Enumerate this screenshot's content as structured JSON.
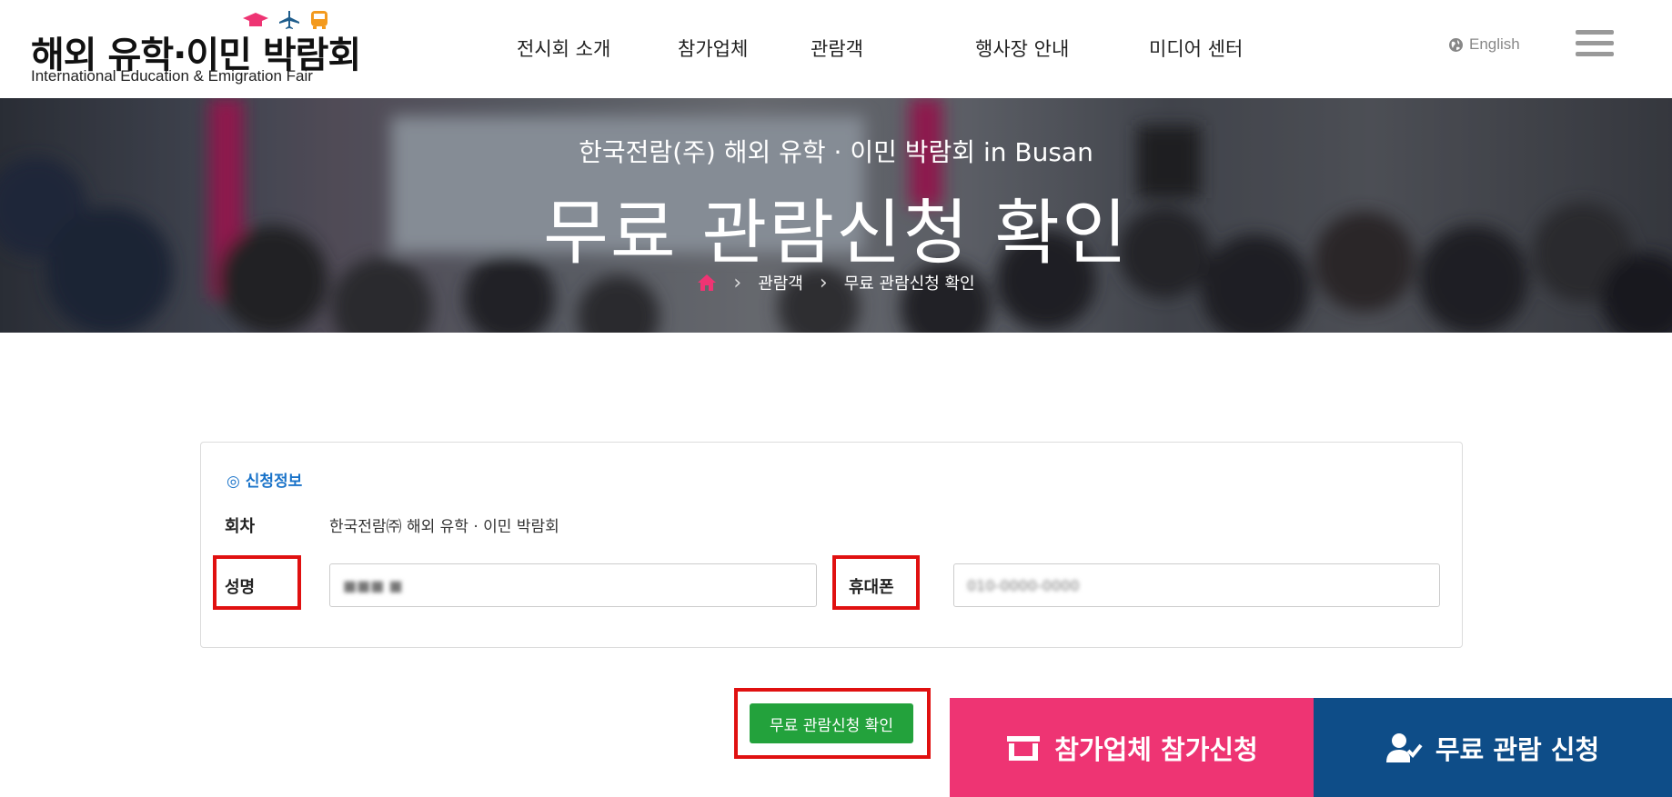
{
  "header": {
    "logo_title": "해외 유학·이민 박람회",
    "logo_subtitle": "International Education & Emigration Fair",
    "logo_icons": [
      "graduation-cap-icon",
      "airplane-icon",
      "bus-icon"
    ],
    "nav": [
      {
        "label": "전시회 소개"
      },
      {
        "label": "참가업체"
      },
      {
        "label": "관람객"
      },
      {
        "label": "행사장 안내"
      },
      {
        "label": "미디어 센터"
      }
    ],
    "language_label": "English"
  },
  "hero": {
    "subtitle": "한국전람(주) 해외 유학 · 이민 박람회 in Busan",
    "title": "무료 관람신청 확인",
    "breadcrumb": [
      "관람객",
      "무료 관람신청 확인"
    ]
  },
  "form": {
    "section_title": "◎ 신청정보",
    "session_label": "회차",
    "session_value": "한국전람㈜ 해외 유학 · 이민 박람회",
    "name_label": "성명",
    "name_value": "■■■ ■",
    "phone_label": "휴대폰",
    "phone_value": "010-0000-0000"
  },
  "confirm_button": "무료 관람신청 확인",
  "cta": {
    "exhibitor_label": "참가업체 참가신청",
    "visitor_label": "무료 관람 신청"
  },
  "colors": {
    "accent_blue": "#1a73c9",
    "confirm_green": "#23a23c",
    "cta_pink": "#ee3473",
    "cta_navy": "#0e4d88",
    "highlight_red": "#e01010",
    "home_icon": "#ee3473"
  }
}
